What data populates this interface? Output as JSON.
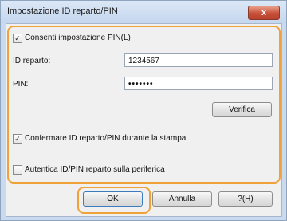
{
  "window": {
    "title": "Impostazione ID reparto/PIN",
    "close_glyph": "x"
  },
  "allow": {
    "checked": true,
    "label": "Consenti impostazione PIN(L)"
  },
  "dept_id": {
    "label": "ID reparto:",
    "value": "1234567"
  },
  "pin": {
    "label": "PIN:",
    "value": "•••••••"
  },
  "verify_button": "Verifica",
  "confirm": {
    "checked": true,
    "label": "Confermare ID reparto/PIN durante la stampa"
  },
  "auth": {
    "checked": false,
    "label": "Autentica ID/PIN reparto sulla periferica"
  },
  "buttons": {
    "ok": "OK",
    "cancel": "Annulla",
    "help": "?(H)"
  },
  "colors": {
    "highlight": "#f0a23a"
  }
}
